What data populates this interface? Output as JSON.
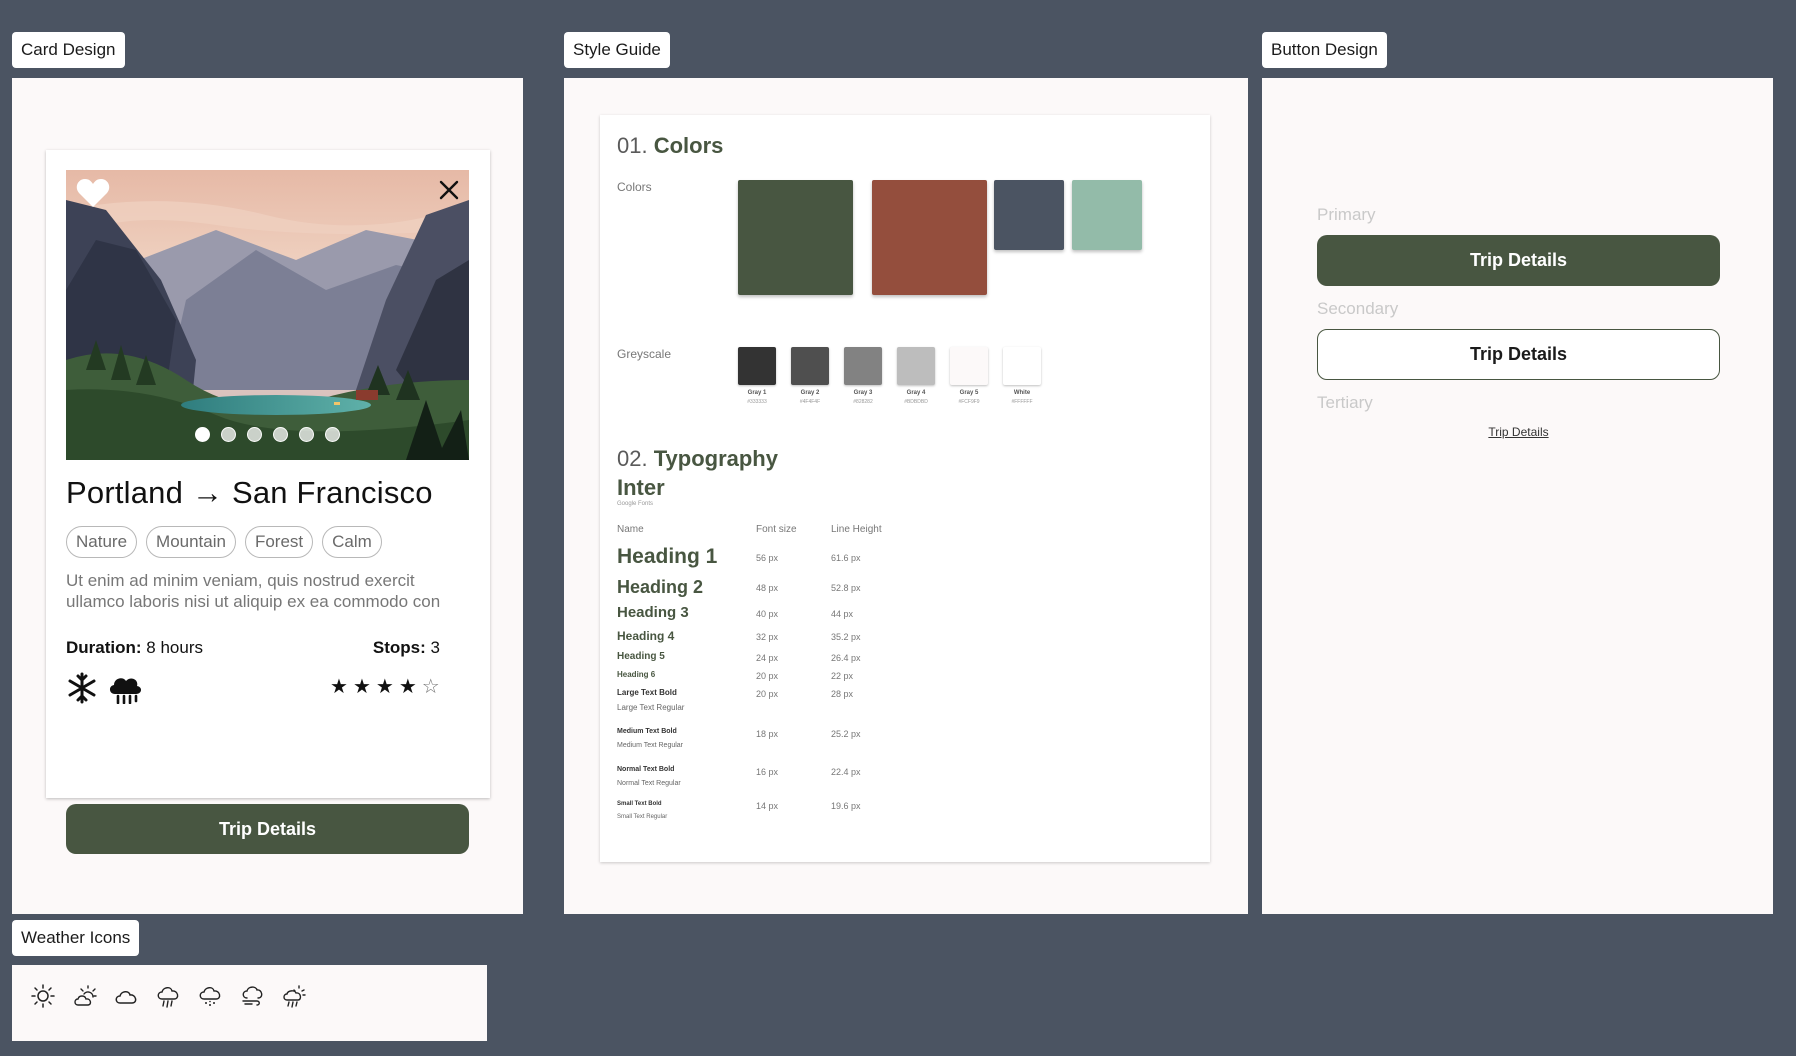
{
  "frames": {
    "card_design": "Card Design",
    "style_guide": "Style Guide",
    "button_design": "Button Design",
    "weather_icons": "Weather Icons"
  },
  "card": {
    "from": "Portland",
    "arrow": "→",
    "to": "San Francisco",
    "tags": [
      "Nature",
      "Mountain",
      "Forest",
      "Calm"
    ],
    "description": "Ut enim ad minim veniam, quis nostrud exercit ullamco laboris nisi ut aliquip ex ea commodo con",
    "duration_label": "Duration:",
    "duration_value": "8 hours",
    "stops_label": "Stops:",
    "stops_value": "3",
    "rating": 4,
    "rating_max": 5,
    "carousel_total": 6,
    "carousel_active": 1,
    "weather_icons": [
      "snowflake-icon",
      "cloud-rain-icon"
    ],
    "cta": "Trip Details"
  },
  "style_guide": {
    "colors_num": "01.",
    "colors_title": "Colors",
    "colors_label": "Colors",
    "brand_colors": [
      "#485641",
      "#944e3d",
      "#4b5462",
      "#93bba9"
    ],
    "greyscale_label": "Greyscale",
    "greys": [
      {
        "name": "Gray 1",
        "hex": "#333333",
        "color": "#333333"
      },
      {
        "name": "Gray 2",
        "hex": "#4F4F4F",
        "color": "#4f4f4f"
      },
      {
        "name": "Gray 3",
        "hex": "#828282",
        "color": "#828282"
      },
      {
        "name": "Gray 4",
        "hex": "#BDBDBD",
        "color": "#bdbdbd"
      },
      {
        "name": "Gray 5",
        "hex": "#FCF9F9",
        "color": "#fcf9f9"
      },
      {
        "name": "White",
        "hex": "#FFFFFF",
        "color": "#ffffff"
      }
    ],
    "typo_num": "02.",
    "typo_title": "Typography",
    "font_name": "Inter",
    "font_source": "Google Fonts",
    "col_name": "Name",
    "col_size": "Font size",
    "col_lh": "Line Height",
    "styles": [
      {
        "name": "Heading 1",
        "size": "56 px",
        "lh": "61.6 px"
      },
      {
        "name": "Heading 2",
        "size": "48 px",
        "lh": "52.8 px"
      },
      {
        "name": "Heading 3",
        "size": "40 px",
        "lh": "44 px"
      },
      {
        "name": "Heading 4",
        "size": "32 px",
        "lh": "35.2 px"
      },
      {
        "name": "Heading 5",
        "size": "24 px",
        "lh": "26.4 px"
      },
      {
        "name": "Heading 6",
        "size": "20 px",
        "lh": "22 px"
      },
      {
        "name": "Large Text Bold",
        "sub": "Large Text Regular",
        "size": "20 px",
        "lh": "28 px"
      },
      {
        "name": "Medium Text Bold",
        "sub": "Medium Text Regular",
        "size": "18 px",
        "lh": "25.2 px"
      },
      {
        "name": "Normal Text Bold",
        "sub": "Normal Text Regular",
        "size": "16 px",
        "lh": "22.4 px"
      },
      {
        "name": "Small Text Bold",
        "sub": "Small Text Regular",
        "size": "14 px",
        "lh": "19.6 px"
      }
    ]
  },
  "buttons": {
    "primary_label": "Primary",
    "primary_text": "Trip Details",
    "secondary_label": "Secondary",
    "secondary_text": "Trip Details",
    "tertiary_label": "Tertiary",
    "tertiary_text": "Trip Details"
  },
  "weather_set": [
    "sun-icon",
    "partly-cloudy-icon",
    "cloud-icon",
    "rain-icon",
    "snow-cloud-icon",
    "wind-cloud-icon",
    "sun-rain-icon"
  ],
  "accent": "#485641"
}
